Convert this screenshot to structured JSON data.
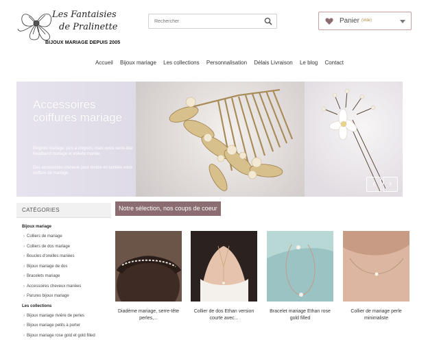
{
  "logo": {
    "line1": "Les Fantaisies",
    "line2": "de Pralinette",
    "tagline": "BIJOUX MARIAGE DEPUIS 2005"
  },
  "search": {
    "placeholder": "Rechercher",
    "icon": "search-icon"
  },
  "cart": {
    "label": "Panier",
    "status": "(vide)",
    "icon": "heart-icon"
  },
  "nav": {
    "items": [
      "Accueil",
      "Bijoux mariage",
      "Les collections",
      "Personnalisation",
      "Délais Livraison",
      "Le blog",
      "Contact"
    ]
  },
  "hero": {
    "title_line1": "Accessoires",
    "title_line2": "coiffures mariage",
    "desc1": "Peignes mariage, pics à chignon, mais aussi serre-tête headband mariage et voilette mariée.",
    "desc2": "Des accessoires cheveux pour mettre en lumière votre coiffure de mariage.",
    "prev": "‹",
    "next": "›"
  },
  "sidebar": {
    "heading": "CATÉGORIES",
    "group1": "Bijoux mariage",
    "items1": [
      "Colliers de mariage",
      "Colliers de dos mariage",
      "Boucles d'oreilles mariées",
      "Bijoux mariage de dos",
      "Bracelets mariage",
      "Accessoires cheveux mariées",
      "Parures bijoux mariage"
    ],
    "group2": "Les collections",
    "items2": [
      "Bijoux mariage rivière de perles",
      "Bijoux mariage petits à porter",
      "Bijoux mariage rose gold et gold filled"
    ]
  },
  "selection": {
    "title": "Notre sélection, nos coups de coeur"
  },
  "products": [
    {
      "name_line1": "Diadème mariage, serre-tête",
      "name_line2": "perles,..."
    },
    {
      "name_line1": "Collier de dos Ethan version",
      "name_line2": "courte avec..."
    },
    {
      "name_line1": "Bracelet mariage Ethan rose",
      "name_line2": "gold filled"
    },
    {
      "name_line1": "Collier de mariage perle",
      "name_line2": "minimaliste"
    }
  ],
  "colors": {
    "accent": "#8b6c70",
    "cart_border": "#c9a0a0",
    "empty_text": "#b48c3a"
  }
}
